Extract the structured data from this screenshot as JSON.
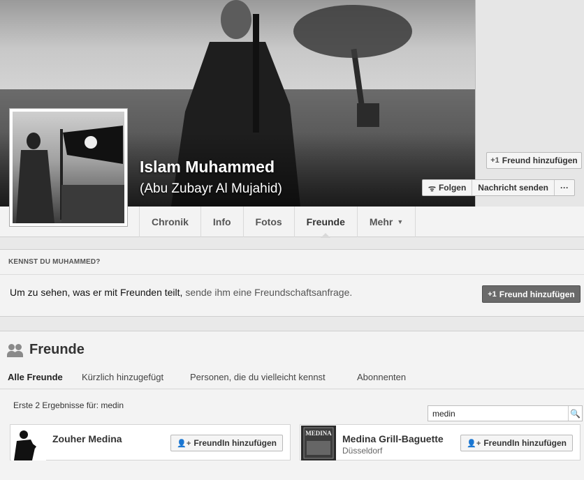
{
  "profile": {
    "name": "Islam Muhammed",
    "alias": "(Abu Zubayr Al Mujahid)"
  },
  "actions": {
    "add_friend": "Freund hinzufügen",
    "follow": "Folgen",
    "message": "Nachricht senden",
    "more": "···"
  },
  "tabs": [
    "Chronik",
    "Info",
    "Fotos",
    "Freunde",
    "Mehr"
  ],
  "know": {
    "heading": "KENNST DU MUHAMMED?",
    "text": "Um zu sehen, was er mit Freunden teilt,",
    "link": "sende ihm eine Freundschaftsanfrage.",
    "button": "Freund hinzufügen"
  },
  "friends": {
    "title": "Freunde",
    "tabs": [
      "Alle Freunde",
      "Kürzlich hinzugefügt",
      "Personen, die du vielleicht kennst",
      "Abonnenten"
    ],
    "search_value": "medin",
    "results_info": "Erste 2 Ergebnisse für: medin",
    "items": [
      {
        "name": "Zouher Medina",
        "sub": "",
        "button": "FreundIn hinzufügen"
      },
      {
        "name": "Medina Grill-Baguette",
        "sub": "Düsseldorf",
        "button": "FreundIn hinzufügen",
        "thumb_text": "MEDINA"
      }
    ]
  }
}
